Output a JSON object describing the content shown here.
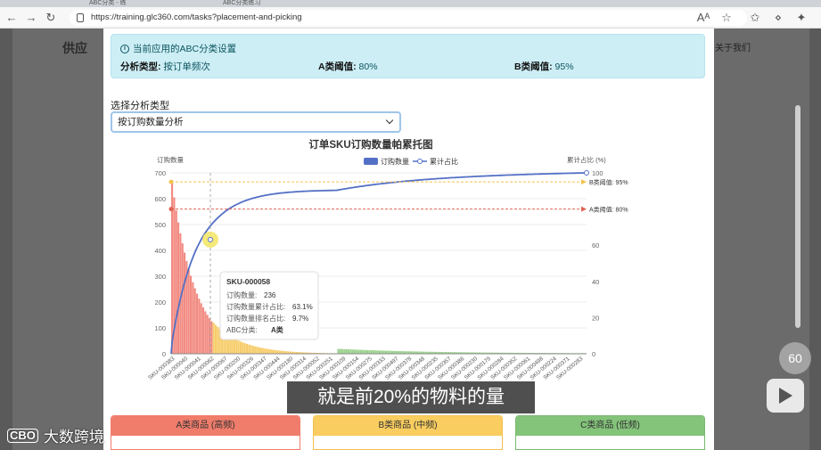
{
  "browser": {
    "tab_fragment_1": "ABC分类 - 练",
    "tab_fragment_2": "ABC分类练习",
    "url": "https://training.glc360.com/tasks?placement-and-picking"
  },
  "background_page": {
    "logo_text": "供应",
    "nav_item": "关于我们"
  },
  "modal": {
    "info": {
      "title": "当前应用的ABC分类设置",
      "analysis_type_label": "分析类型:",
      "analysis_type_value": "按订单频次",
      "a_threshold_label": "A类阈值:",
      "a_threshold_value": "80%",
      "b_threshold_label": "B类阈值:",
      "b_threshold_value": "95%"
    },
    "select": {
      "label": "选择分析类型",
      "value": "按订购数量分析"
    },
    "cards": [
      {
        "label": "A类商品 (高频)",
        "color": "#f07c6b",
        "border": "#f07c6b"
      },
      {
        "label": "B类商品 (中频)",
        "color": "#f9cd5f",
        "border": "#f2c04f"
      },
      {
        "label": "C类商品 (低频)",
        "color": "#84c37a",
        "border": "#79b86f"
      }
    ]
  },
  "chart_data": {
    "type": "bar",
    "title": "订单SKU订购数量帕累托图",
    "legend": [
      {
        "name": "订购数量",
        "color": "#5470c6"
      },
      {
        "name": "累计占比",
        "color": "#5470c6"
      }
    ],
    "legend_position": "top-center",
    "ylabel_left": "订购数量",
    "ylabel_right": "累计占比 (%)",
    "ylim_left": [
      0,
      700
    ],
    "yticks_left": [
      0,
      100,
      200,
      300,
      400,
      500,
      600,
      700
    ],
    "ylim_right": [
      0,
      100
    ],
    "yticks_right": [
      0,
      20,
      40,
      60,
      100
    ],
    "x_tick_labels": [
      "SKU-000383",
      "SKU-000040",
      "SKU-000041",
      "SKU-000062",
      "SKU-000067",
      "SKU-000200",
      "SKU-000326",
      "SKU-000347",
      "SKU-000444",
      "SKU-000180",
      "SKU-000314",
      "SKU-000052",
      "SKU-000251",
      "SKU-000109",
      "SKU-000154",
      "SKU-000275",
      "SKU-000333",
      "SKU-000497",
      "SKU-000378",
      "SKU-000348",
      "SKU-000235",
      "SKU-000357",
      "SKU-000386",
      "SKU-000230",
      "SKU-000179",
      "SKU-000284",
      "SKU-000352",
      "SKU-000061",
      "SKU-000498",
      "SKU-000224",
      "SKU-000371",
      "SKU-000283"
    ],
    "bar_profile": {
      "n": 200,
      "a_count": 20,
      "b_count": 60,
      "max_value": 660,
      "colors": {
        "A": "#f28b82",
        "B": "#f7cd6b",
        "C": "#9ad28d"
      }
    },
    "cumulative_line_color": "#5470c6",
    "mark_lines": [
      {
        "label": "B类阈值: 95%",
        "value": 95,
        "color": "#f3c24e"
      },
      {
        "label": "A类阈值: 80%",
        "value": 80,
        "color": "#e06454"
      }
    ],
    "tooltip": {
      "title": "SKU-000058",
      "rows": [
        {
          "label": "订购数量:",
          "value": "236"
        },
        {
          "label": "订购数量累计占比:",
          "value": "63.1%"
        },
        {
          "label": "订购数量排名占比:",
          "value": "9.7%"
        },
        {
          "label": "ABC分类:",
          "value": "A类"
        }
      ]
    }
  },
  "overlays": {
    "subtitle": "就是前20%的物料的量",
    "watermark": "大数跨境",
    "watermark_logo": "CBO",
    "speed": "60"
  }
}
